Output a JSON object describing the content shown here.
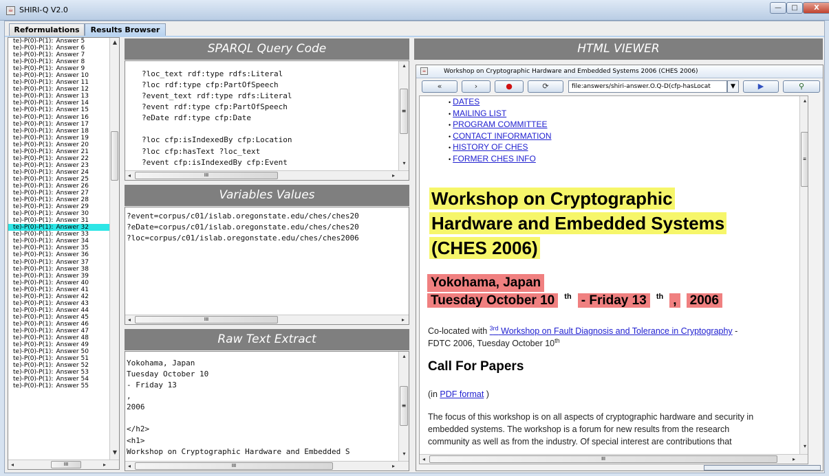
{
  "window": {
    "title": "SHIRI-Q V2.0",
    "icon": "java-cup-icon",
    "min": "—",
    "max": "□",
    "close": "X"
  },
  "tabs": [
    {
      "label": "Reformulations"
    },
    {
      "label": "Results Browser"
    }
  ],
  "answers": {
    "selected_index": 27,
    "items": [
      {
        "prefix": "te)-P(0)-P(1):",
        "label": "Answer 5"
      },
      {
        "prefix": "te)-P(0)-P(1):",
        "label": "Answer 6"
      },
      {
        "prefix": "te)-P(0)-P(1):",
        "label": "Answer 7"
      },
      {
        "prefix": "te)-P(0)-P(1):",
        "label": "Answer 8"
      },
      {
        "prefix": "te)-P(0)-P(1):",
        "label": "Answer 9"
      },
      {
        "prefix": "te)-P(0)-P(1):",
        "label": "Answer 10"
      },
      {
        "prefix": "te)-P(0)-P(1):",
        "label": "Answer 11"
      },
      {
        "prefix": "te)-P(0)-P(1):",
        "label": "Answer 12"
      },
      {
        "prefix": "te)-P(0)-P(1):",
        "label": "Answer 13"
      },
      {
        "prefix": "te)-P(0)-P(1):",
        "label": "Answer 14"
      },
      {
        "prefix": "te)-P(0)-P(1):",
        "label": "Answer 15"
      },
      {
        "prefix": "te)-P(0)-P(1):",
        "label": "Answer 16"
      },
      {
        "prefix": "te)-P(0)-P(1):",
        "label": "Answer 17"
      },
      {
        "prefix": "te)-P(0)-P(1):",
        "label": "Answer 18"
      },
      {
        "prefix": "te)-P(0)-P(1):",
        "label": "Answer 19"
      },
      {
        "prefix": "te)-P(0)-P(1):",
        "label": "Answer 20"
      },
      {
        "prefix": "te)-P(0)-P(1):",
        "label": "Answer 21"
      },
      {
        "prefix": "te)-P(0)-P(1):",
        "label": "Answer 22"
      },
      {
        "prefix": "te)-P(0)-P(1):",
        "label": "Answer 23"
      },
      {
        "prefix": "te)-P(0)-P(1):",
        "label": "Answer 24"
      },
      {
        "prefix": "te)-P(0)-P(1):",
        "label": "Answer 25"
      },
      {
        "prefix": "te)-P(0)-P(1):",
        "label": "Answer 26"
      },
      {
        "prefix": "te)-P(0)-P(1):",
        "label": "Answer 27"
      },
      {
        "prefix": "te)-P(0)-P(1):",
        "label": "Answer 28"
      },
      {
        "prefix": "te)-P(0)-P(1):",
        "label": "Answer 29"
      },
      {
        "prefix": "te)-P(0)-P(1):",
        "label": "Answer 30"
      },
      {
        "prefix": "te)-P(0)-P(1):",
        "label": "Answer 31"
      },
      {
        "prefix": "te)-P(0)-P(1):",
        "label": "Answer 32"
      },
      {
        "prefix": "te)-P(0)-P(1):",
        "label": "Answer 33"
      },
      {
        "prefix": "te)-P(0)-P(1):",
        "label": "Answer 34"
      },
      {
        "prefix": "te)-P(0)-P(1):",
        "label": "Answer 35"
      },
      {
        "prefix": "te)-P(0)-P(1):",
        "label": "Answer 36"
      },
      {
        "prefix": "te)-P(0)-P(1):",
        "label": "Answer 37"
      },
      {
        "prefix": "te)-P(0)-P(1):",
        "label": "Answer 38"
      },
      {
        "prefix": "te)-P(0)-P(1):",
        "label": "Answer 39"
      },
      {
        "prefix": "te)-P(0)-P(1):",
        "label": "Answer 40"
      },
      {
        "prefix": "te)-P(0)-P(1):",
        "label": "Answer 41"
      },
      {
        "prefix": "te)-P(0)-P(1):",
        "label": "Answer 42"
      },
      {
        "prefix": "te)-P(0)-P(1):",
        "label": "Answer 43"
      },
      {
        "prefix": "te)-P(0)-P(1):",
        "label": "Answer 44"
      },
      {
        "prefix": "te)-P(0)-P(1):",
        "label": "Answer 45"
      },
      {
        "prefix": "te)-P(0)-P(1):",
        "label": "Answer 46"
      },
      {
        "prefix": "te)-P(0)-P(1):",
        "label": "Answer 47"
      },
      {
        "prefix": "te)-P(0)-P(1):",
        "label": "Answer 48"
      },
      {
        "prefix": "te)-P(0)-P(1):",
        "label": "Answer 49"
      },
      {
        "prefix": "te)-P(0)-P(1):",
        "label": "Answer 50"
      },
      {
        "prefix": "te)-P(0)-P(1):",
        "label": "Answer 51"
      },
      {
        "prefix": "te)-P(0)-P(1):",
        "label": "Answer 52"
      },
      {
        "prefix": "te)-P(0)-P(1):",
        "label": "Answer 53"
      },
      {
        "prefix": "te)-P(0)-P(1):",
        "label": "Answer 54"
      },
      {
        "prefix": "te)-P(0)-P(1):",
        "label": "Answer 55"
      }
    ]
  },
  "sparql": {
    "title": "SPARQL Query Code",
    "lines": [
      "?loc_text rdf:type rdfs:Literal",
      "?loc rdf:type cfp:PartOfSpeech",
      "?event_text rdf:type rdfs:Literal",
      "?event rdf:type cfp:PartOfSpeech",
      "?eDate rdf:type cfp:Date",
      "",
      "?loc cfp:isIndexedBy cfp:Location",
      "?loc cfp:hasText ?loc_text",
      "?event cfp:isIndexedBy cfp:Event"
    ]
  },
  "variables": {
    "title": "Variables Values",
    "lines": [
      "?event=corpus/c01/islab.oregonstate.edu/ches/ches20",
      "?eDate=corpus/c01/islab.oregonstate.edu/ches/ches20",
      "?loc=corpus/c01/islab.oregonstate.edu/ches/ches2006"
    ]
  },
  "raw": {
    "title": "Raw Text Extract",
    "lines": [
      "Yokohama, Japan",
      "Tuesday October 10",
      "- Friday 13",
      ",",
      "2006",
      "",
      "</h2>",
      "<h1>",
      "Workshop on Cryptographic Hardware and Embedded S"
    ]
  },
  "html_viewer": {
    "title": "HTML VIEWER",
    "browser_title": "Workshop on Cryptographic Hardware and Embedded Systems 2006     (CHES 2006)",
    "url": "file:answers/shiri-answer.O.Q-D(cfp-hasLocat",
    "toolbar": {
      "back": "«",
      "forward": "›",
      "stop": "●",
      "reload": "⟳",
      "go": "▶",
      "find": "⚲"
    },
    "nav_links": [
      "DATES",
      "MAILING LIST",
      "PROGRAM COMMITTEE",
      "CONTACT INFORMATION",
      "HISTORY OF CHES",
      "FORMER CHES INFO"
    ],
    "heading_lines": [
      "Workshop on Cryptographic",
      "Hardware and Embedded Systems",
      "(CHES 2006)"
    ],
    "location": "Yokohama, Japan",
    "date": {
      "part1": "Tuesday October 10",
      "sup1": "th",
      "part2": "- Friday 13",
      "sup2": "th",
      "comma": ",",
      "year": "2006"
    },
    "colocated": {
      "prefix": "Co-located with",
      "link_sup": "3",
      "link_sup_suffix": "rd",
      "link": "Workshop on Fault Diagnosis and Tolerance in Cryptography",
      "suffix": "-",
      "line2": "FDTC 2006, Tuesday October 10",
      "line2_sup": "th"
    },
    "call_heading": "Call For Papers",
    "pdf": {
      "open": "(in",
      "link": "PDF format",
      "close": ")"
    },
    "body_lines": [
      "The focus of this workshop is on all aspects of cryptographic hardware and security in",
      "embedded systems. The workshop is a forum for new results from the research",
      "community as well as from the industry. Of special interest are contributions that"
    ]
  },
  "scroll_marks": {
    "h": "III",
    "v": "≡"
  }
}
